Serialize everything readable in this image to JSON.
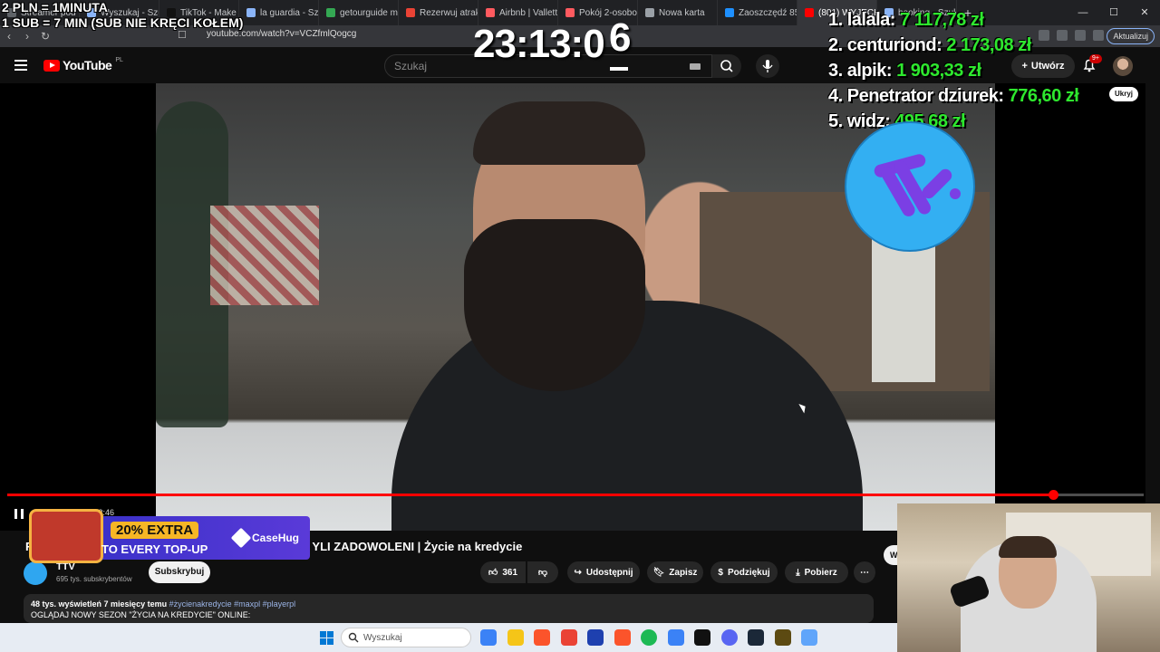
{
  "browser": {
    "tabs": [
      {
        "label": "Streamer pod",
        "color": "#5f6368"
      },
      {
        "label": "Wyszukaj - Szuka",
        "color": "#8ab4f8"
      },
      {
        "label": "TikTok - Make Yo",
        "color": "#111111"
      },
      {
        "label": "la guardia - Szuk",
        "color": "#8ab4f8"
      },
      {
        "label": "getourguide ma",
        "color": "#34a853"
      },
      {
        "label": "Rezerwuj atrakc",
        "color": "#ea4335"
      },
      {
        "label": "Airbnb | Vallett",
        "color": "#ff5a5f"
      },
      {
        "label": "Pokój 2-osobo",
        "color": "#ff5a5f"
      },
      {
        "label": "Nowa karta",
        "color": "#9aa0a6"
      },
      {
        "label": "Zaoszczędź 85",
        "color": "#1e90ff"
      },
      {
        "label": "(801) WYJECH",
        "color": "#ff0000"
      },
      {
        "label": "booking - Szuk",
        "color": "#8ab4f8"
      }
    ],
    "url": "youtube.com/watch?v=VCZfmlQogcg",
    "update_label": "Aktualizuj"
  },
  "youtube": {
    "logo_text": "YouTube",
    "region": "PL",
    "search_placeholder": "Szukaj",
    "create_label": "Utwórz",
    "notif_badge": "9+",
    "hide_label": "Ukryj",
    "time_readout": "2 / 3:46",
    "progress_fraction": 0.92,
    "video_title_start": "R",
    "video_title": "YLI ZADOWOLENI | Życie na kredycie",
    "channel_name": "TTV",
    "subscribers": "695 tys. subskrybentów",
    "subscribe_label": "Subskrybuj",
    "likes": "361",
    "share_label": "Udostępnij",
    "clip_label": "Zapisz",
    "thanks_label": "Podziękuj",
    "download_label": "Pobierz",
    "desc_stats": "48 tys. wyświetleń  7 miesięcy temu",
    "desc_tags": "#życienakredycie #maxpl #playerpl",
    "desc_line": "OGLĄDAJ NOWY SEZON \"ŻYCIA NA KREDYCIE\" ONLINE:",
    "side_button": "W"
  },
  "overlay": {
    "rule1": "2 PLN = 1MINUTA",
    "rule2": "1 SUB = 7 MIN (SUB NIE KRĘCI KOŁEM)",
    "timer": "23:13:0",
    "timer_sup": "6",
    "leaderboard": [
      {
        "rank": "1.",
        "name": "lalala:",
        "amount": "7 117,78 zł"
      },
      {
        "rank": "2.",
        "name": "centuriond:",
        "amount": "2 173,08 zł"
      },
      {
        "rank": "3.",
        "name": "alpik:",
        "amount": "1 903,33 zł"
      },
      {
        "rank": "4.",
        "name": "Penetrator dziurek:",
        "amount": "776,60 zł"
      },
      {
        "rank": "5.",
        "name": "widz:",
        "amount": "495,68 zł"
      }
    ],
    "ad_pill": "20% EXTRA",
    "ad_sub": "TO EVERY TOP-UP",
    "ad_brand": "CaseHug"
  },
  "taskbar": {
    "search_placeholder": "Wyszukaj",
    "apps": [
      "#3b82f6",
      "#f5c518",
      "#fb542b",
      "#ea4335",
      "#1e40af",
      "#fb542b",
      "#1db954",
      "#3b82f6",
      "#111111",
      "#5865f2",
      "#1b2838",
      "#5c4a12",
      "#60a5fa"
    ]
  }
}
